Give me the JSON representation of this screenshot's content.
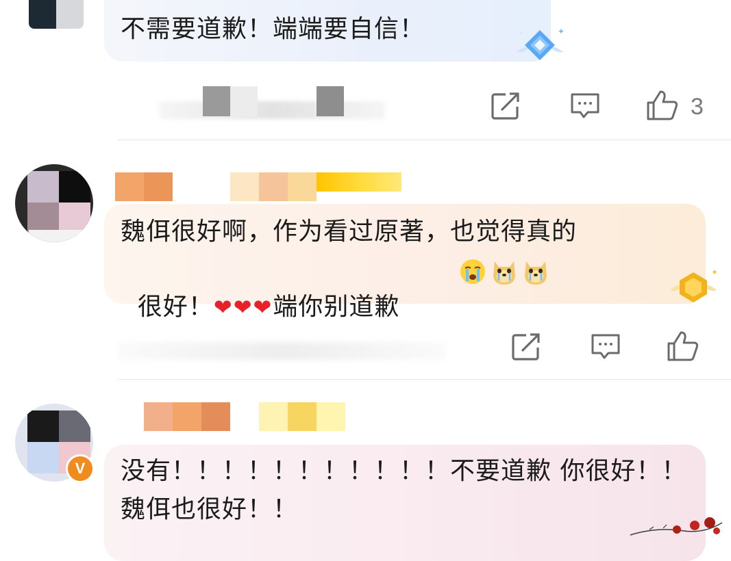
{
  "comments": [
    {
      "text": "不需要道歉！端端要自信！",
      "actions": {
        "share_icon": "share-icon",
        "reply_icon": "comment-icon",
        "like_icon": "thumbs-up-icon",
        "like_count": "3"
      }
    },
    {
      "text_line1": "魏佴很好啊，作为看过原著，也觉得真的",
      "text_line2_a": "很好！",
      "hearts": "❤❤❤",
      "text_line2_b": "端你别道歉",
      "actions": {
        "share_icon": "share-icon",
        "reply_icon": "comment-icon",
        "like_icon": "thumbs-up-icon"
      }
    },
    {
      "text_line1": "没有！！！！！！！！！！！不要道歉 你很好！！",
      "text_line2": "魏佴也很好！！",
      "verified_badge": "V"
    }
  ],
  "colors": {
    "heart": "#e8202a",
    "verified": "#f08c1e",
    "badge_blue": "#4a9cf0",
    "badge_gold": "#f2b21c"
  }
}
